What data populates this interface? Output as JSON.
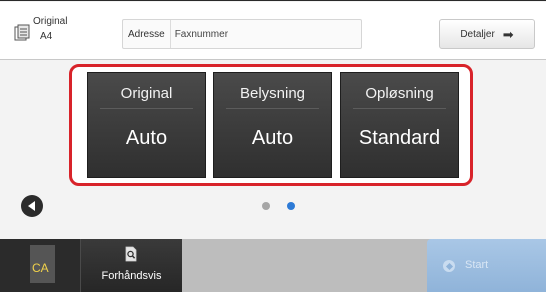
{
  "header": {
    "original_label": "Original",
    "original_size": "A4",
    "address_label": "Adresse",
    "address_placeholder": "Faxnummer",
    "details_label": "Detaljer"
  },
  "settings": {
    "tiles": [
      {
        "title": "Original",
        "value": "Auto"
      },
      {
        "title": "Belysning",
        "value": "Auto"
      },
      {
        "title": "Opløsning",
        "value": "Standard"
      }
    ],
    "highlight_color": "#d8232a"
  },
  "pager": {
    "page_count": 2,
    "current_page": 2,
    "active_color": "#2d7ad6",
    "inactive_color": "#a6a6a6"
  },
  "footer": {
    "ca_label": "CA",
    "preview_label": "Forhåndsvis",
    "start_label": "Start",
    "start_enabled": false
  },
  "icons": {
    "original": "document-icon",
    "details_arrow": "arrow-right-icon",
    "back": "back-arrow-icon",
    "preview": "preview-magnifier-icon",
    "start": "start-diamond-icon"
  }
}
